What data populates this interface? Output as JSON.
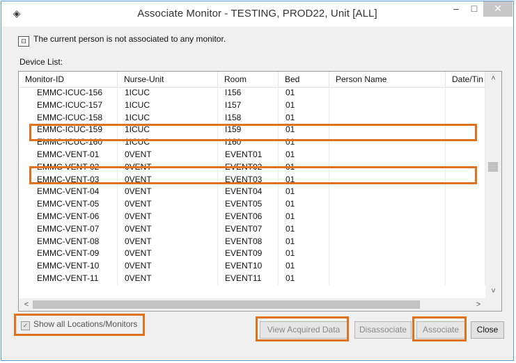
{
  "window": {
    "title": "Associate Monitor - TESTING, PROD22, Unit [ALL]",
    "app_icon": "monitor-icon",
    "controls": {
      "minimize": "–",
      "maximize": "□",
      "close": "✕"
    }
  },
  "info": {
    "icon": "person-unlinked-icon",
    "message": "The current person is not associated to any monitor."
  },
  "device_list": {
    "label": "Device List:",
    "columns": [
      "Monitor-ID",
      "Nurse-Unit",
      "Room",
      "Bed",
      "Person Name",
      "Date/Tin"
    ],
    "rows": [
      [
        "EMMC-ICUC-156",
        "1ICUC",
        "I156",
        "01",
        "",
        ""
      ],
      [
        "EMMC-ICUC-157",
        "1ICUC",
        "I157",
        "01",
        "",
        ""
      ],
      [
        "EMMC-ICUC-158",
        "1ICUC",
        "I158",
        "01",
        "",
        ""
      ],
      [
        "EMMC-ICUC-159",
        "1ICUC",
        "I159",
        "01",
        "",
        ""
      ],
      [
        "EMMC-ICUC-160",
        "1ICUC",
        "I160",
        "01",
        "",
        ""
      ],
      [
        "EMMC-VENT-01",
        "0VENT",
        "EVENT01",
        "01",
        "",
        ""
      ],
      [
        "EMMC-VENT-02",
        "0VENT",
        "EVENT02",
        "01",
        "",
        ""
      ],
      [
        "EMMC-VENT-03",
        "0VENT",
        "EVENT03",
        "01",
        "",
        ""
      ],
      [
        "EMMC-VENT-04",
        "0VENT",
        "EVENT04",
        "01",
        "",
        ""
      ],
      [
        "EMMC-VENT-05",
        "0VENT",
        "EVENT05",
        "01",
        "",
        ""
      ],
      [
        "EMMC-VENT-06",
        "0VENT",
        "EVENT06",
        "01",
        "",
        ""
      ],
      [
        "EMMC-VENT-07",
        "0VENT",
        "EVENT07",
        "01",
        "",
        ""
      ],
      [
        "EMMC-VENT-08",
        "0VENT",
        "EVENT08",
        "01",
        "",
        ""
      ],
      [
        "EMMC-VENT-09",
        "0VENT",
        "EVENT09",
        "01",
        "",
        ""
      ],
      [
        "EMMC-VENT-10",
        "0VENT",
        "EVENT10",
        "01",
        "",
        ""
      ],
      [
        "EMMC-VENT-11",
        "0VENT",
        "EVENT11",
        "01",
        "",
        ""
      ]
    ],
    "scroll": {
      "up": "˄",
      "down": "˅",
      "left": "<",
      "right": ">"
    }
  },
  "footer": {
    "show_all_label": "Show all Locations/Monitors",
    "show_all_checked": true,
    "check_glyph": "✓",
    "buttons": {
      "view_acquired": "View Acquired Data",
      "disassociate": "Disassociate",
      "associate": "Associate",
      "close": "Close"
    }
  },
  "colors": {
    "highlight": "#e0711f",
    "window_border": "#5b9bd5"
  }
}
